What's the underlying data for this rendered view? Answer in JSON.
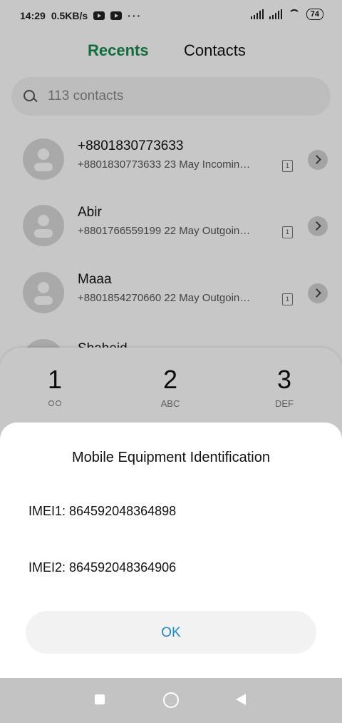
{
  "status_bar": {
    "time": "14:29",
    "speed": "0.5KB/s",
    "overflow": "···",
    "battery": "74",
    "icons": [
      "youtube-icon",
      "youtube-icon",
      "signal-icon",
      "signal-icon",
      "wifi-icon",
      "battery-icon"
    ]
  },
  "tabs": {
    "recents": "Recents",
    "contacts": "Contacts",
    "active": "recents"
  },
  "search": {
    "placeholder": "113 contacts"
  },
  "recents": [
    {
      "name": "+8801830773633",
      "detail": "+8801830773633  23 May Incomin…",
      "sim": "1"
    },
    {
      "name": "Abir",
      "detail": "+8801766559199  22 May Outgoin…",
      "sim": "1"
    },
    {
      "name": "Maaa",
      "detail": "+8801854270660  22 May Outgoin…",
      "sim": "1"
    }
  ],
  "partial_row": {
    "name": "Shaheid"
  },
  "keypad": [
    {
      "digit": "1",
      "sub": ""
    },
    {
      "digit": "2",
      "sub": "ABC"
    },
    {
      "digit": "3",
      "sub": "DEF"
    }
  ],
  "dialog": {
    "title": "Mobile Equipment Identification",
    "imei1": "IMEI1: 864592048364898",
    "imei2": "IMEI2: 864592048364906",
    "ok_label": "OK"
  },
  "colors": {
    "accent_green": "#168c4a",
    "ok_blue": "#1c87c9"
  }
}
